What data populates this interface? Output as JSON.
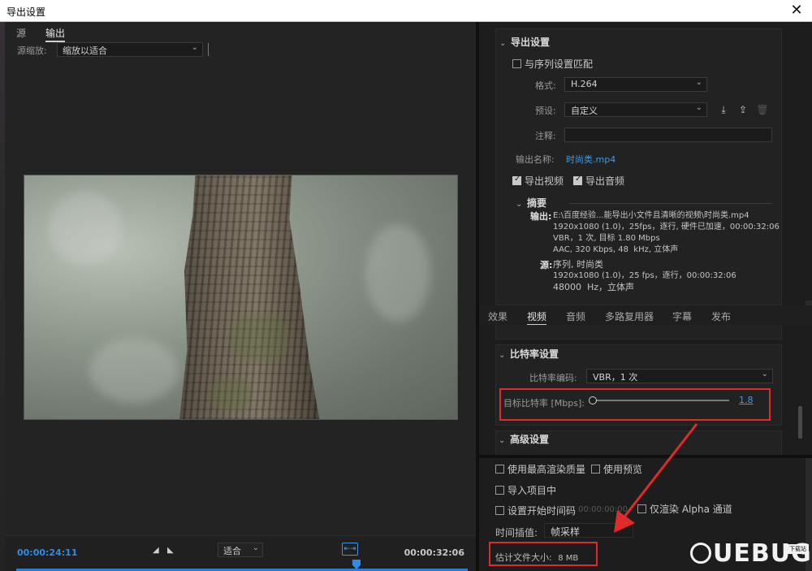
{
  "window": {
    "title": "导出设置",
    "close_glyph": "✕"
  },
  "left": {
    "tabs": [
      {
        "label": "源"
      },
      {
        "label": "输出"
      }
    ],
    "zoom_label": "源缩放:",
    "zoom_value": "缩放以适合",
    "current_time": "00:00:24:11",
    "total_time": "00:00:32:06",
    "fit_value": "适合"
  },
  "export": {
    "section_title": "导出设置",
    "match_sequence": "与序列设置匹配",
    "format_label": "格式:",
    "format_value": "H.264",
    "preset_label": "预设:",
    "preset_value": "自定义",
    "comment_label": "注释:",
    "comment_value": "",
    "output_name_label": "输出名称:",
    "output_name_value": "时尚类.mp4",
    "export_video": "导出视频",
    "export_audio": "导出音频"
  },
  "summary": {
    "title": "摘要",
    "output_key": "输出:",
    "output_lines": [
      "E:\\百度经验...能导出小文件且清晰的视频\\时尚类.mp4",
      "1920x1080 (1.0)，25fps，逐行, 硬件已加速，00:00:32:06",
      "VBR，1 次, 目标 1.80 Mbps",
      "AAC, 320 Kbps, 48  kHz, 立体声"
    ],
    "source_key": "源:",
    "source_lines": [
      "序列, 时尚类",
      "1920x1080 (1.0)，25 fps，逐行，00:00:32:06",
      "48000  Hz，立体声"
    ]
  },
  "tabs": [
    {
      "label": "效果"
    },
    {
      "label": "视频"
    },
    {
      "label": "音频"
    },
    {
      "label": "多路复用器"
    },
    {
      "label": "字幕"
    },
    {
      "label": "发布"
    }
  ],
  "bitrate": {
    "section_title": "比特率设置",
    "encoding_label": "比特率编码:",
    "encoding_value": "VBR，1 次",
    "target_label": "目标比特率 [Mbps]:",
    "target_value": "1.8",
    "slider_fraction": 0.0
  },
  "advanced": {
    "section_title": "高级设置"
  },
  "bottom": {
    "max_quality": "使用最高渲染质量",
    "use_preview": "使用预览",
    "import_project": "导入项目中",
    "set_start_tc": "设置开始时间码",
    "start_tc_value": "00:00:00:00",
    "alpha_only": "仅渲染 Alpha 通道",
    "interp_label": "时间插值:",
    "interp_value": "帧采样",
    "filesize_label": "估计文件大小:",
    "filesize_value": "8 MB"
  },
  "watermark": {
    "text": "UEBUG",
    "badge": "下载站"
  },
  "colors": {
    "accent": "#2d8ceb",
    "link": "#3b9aeb",
    "annotation": "#e02b2b"
  }
}
